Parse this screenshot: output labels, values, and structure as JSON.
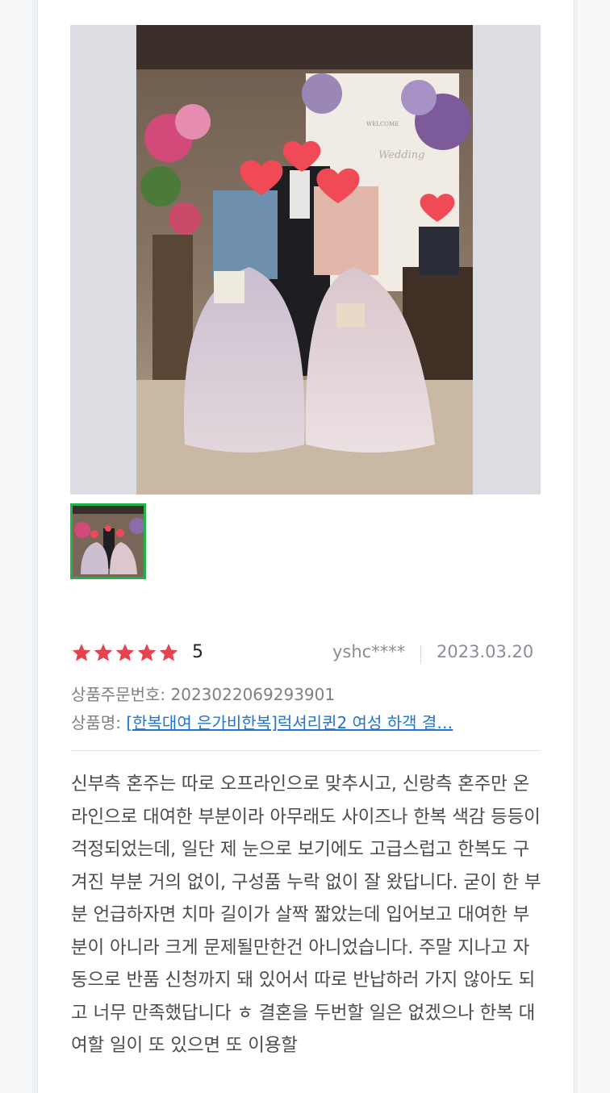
{
  "review": {
    "rating_value": "5",
    "star_count": 5,
    "star_color": "#e5434f",
    "user_id": "yshc****",
    "date": "2023.03.20",
    "order_number_label": "상품주문번호:",
    "order_number": "2023022069293901",
    "product_label": "상품명:",
    "product_name": "[한복대여 은가비한복]럭셔리퀸2 여성 하객 결…",
    "body": "신부측 혼주는 따로 오프라인으로 맞추시고, 신랑측 혼주만 온라인으로 대여한 부분이라 아무래도 사이즈나 한복 색감 등등이 걱정되었는데, 일단 제 눈으로 보기에도 고급스럽고 한복도 구겨진 부분 거의 없이, 구성품 누락 없이 잘 왔답니다. 굳이 한 부분 언급하자면 치마 길이가 살짝 짧았는데 입어보고 대여한 부분이 아니라 크게 문제될만한건 아니었습니다. 주말 지나고 자동으로 반품 신청까지 돼 있어서 따로 반납하러 가지 않아도 되고 너무 만족했답니다 ㅎ 결혼을 두번할 일은 없겠으나 한복 대여할 일이 또 있으면 또 이용할"
  },
  "colors": {
    "accent_green": "#21b34a",
    "link_blue": "#1f74d4"
  }
}
